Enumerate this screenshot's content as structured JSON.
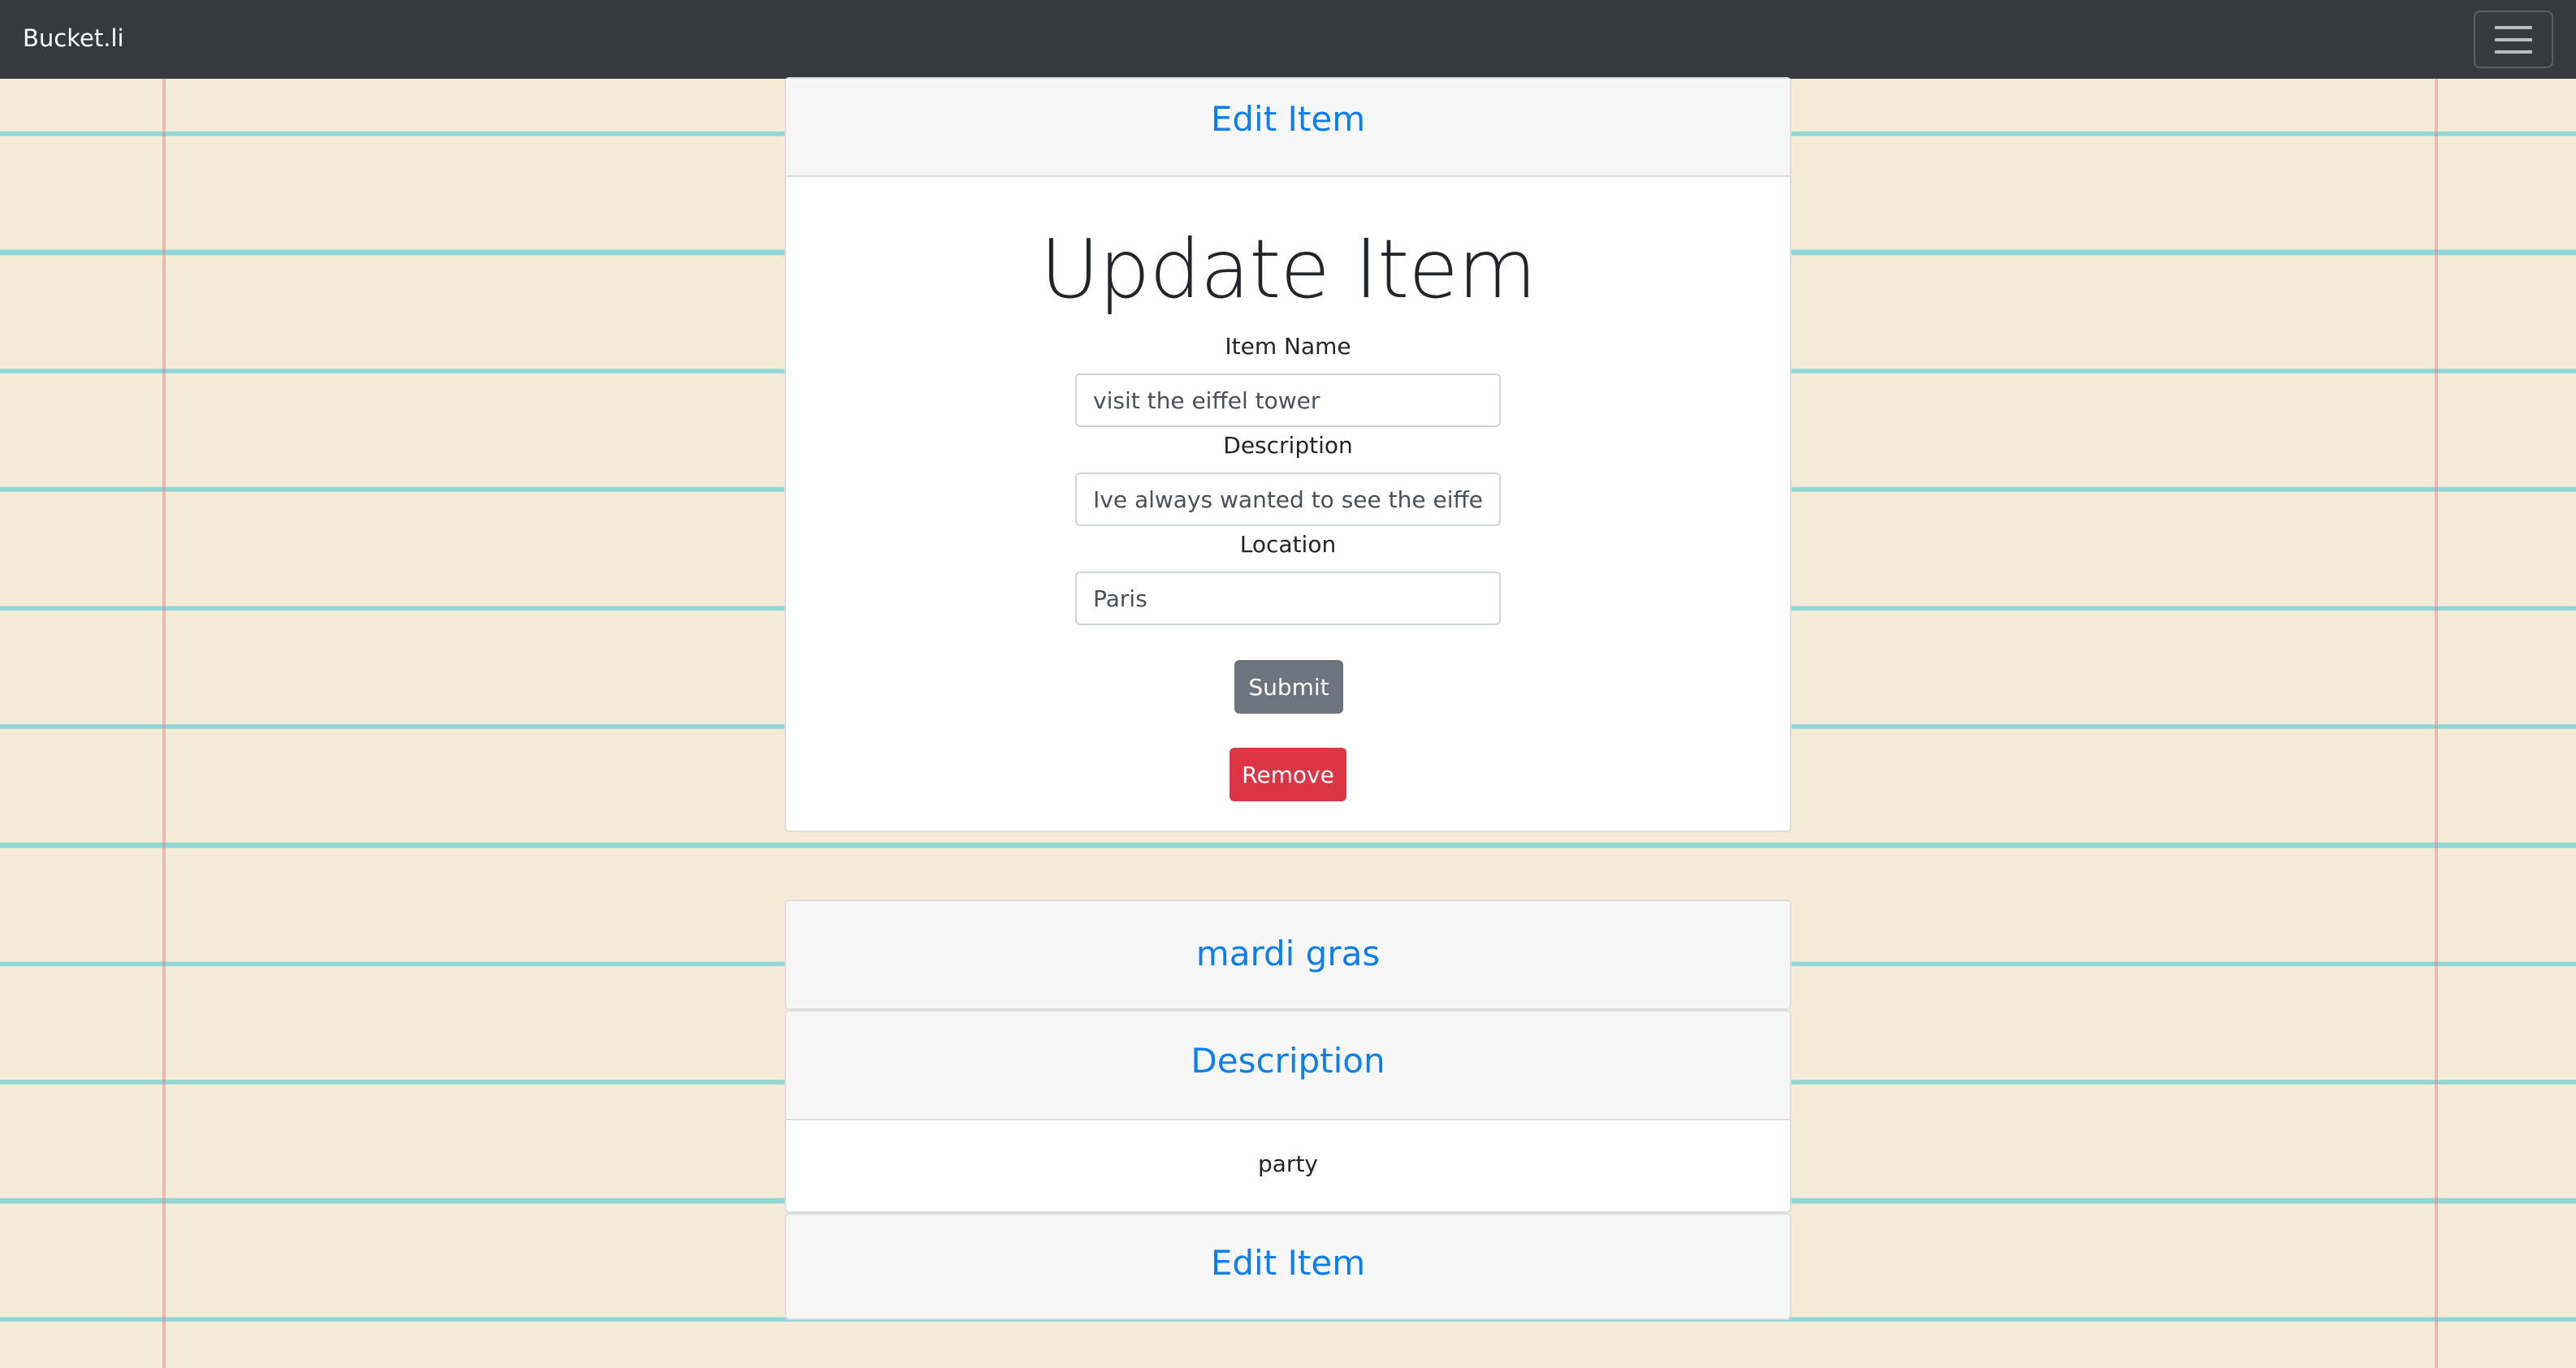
{
  "navbar": {
    "brand": "Bucket.li",
    "menu_icon": "hamburger-menu-icon"
  },
  "edit_card": {
    "header_link": "Edit Item",
    "form_title": "Update Item",
    "fields": [
      {
        "label": "Item Name",
        "value": "visit the eiffel tower",
        "placeholder": ""
      },
      {
        "label": "Description",
        "value": "Ive always wanted to see the eiffel tower",
        "placeholder": ""
      },
      {
        "label": "Location",
        "value": "Paris",
        "placeholder": ""
      }
    ],
    "submit_label": "Submit",
    "remove_label": "Remove"
  },
  "item_card": {
    "title": "mardi gras",
    "description_header": "Description",
    "description_text": "party",
    "edit_link": "Edit Item"
  },
  "colors": {
    "navbar_bg": "#343a40",
    "link": "#0b7ff0",
    "submit_bg": "#6c757d",
    "remove_bg": "#dc3545"
  }
}
